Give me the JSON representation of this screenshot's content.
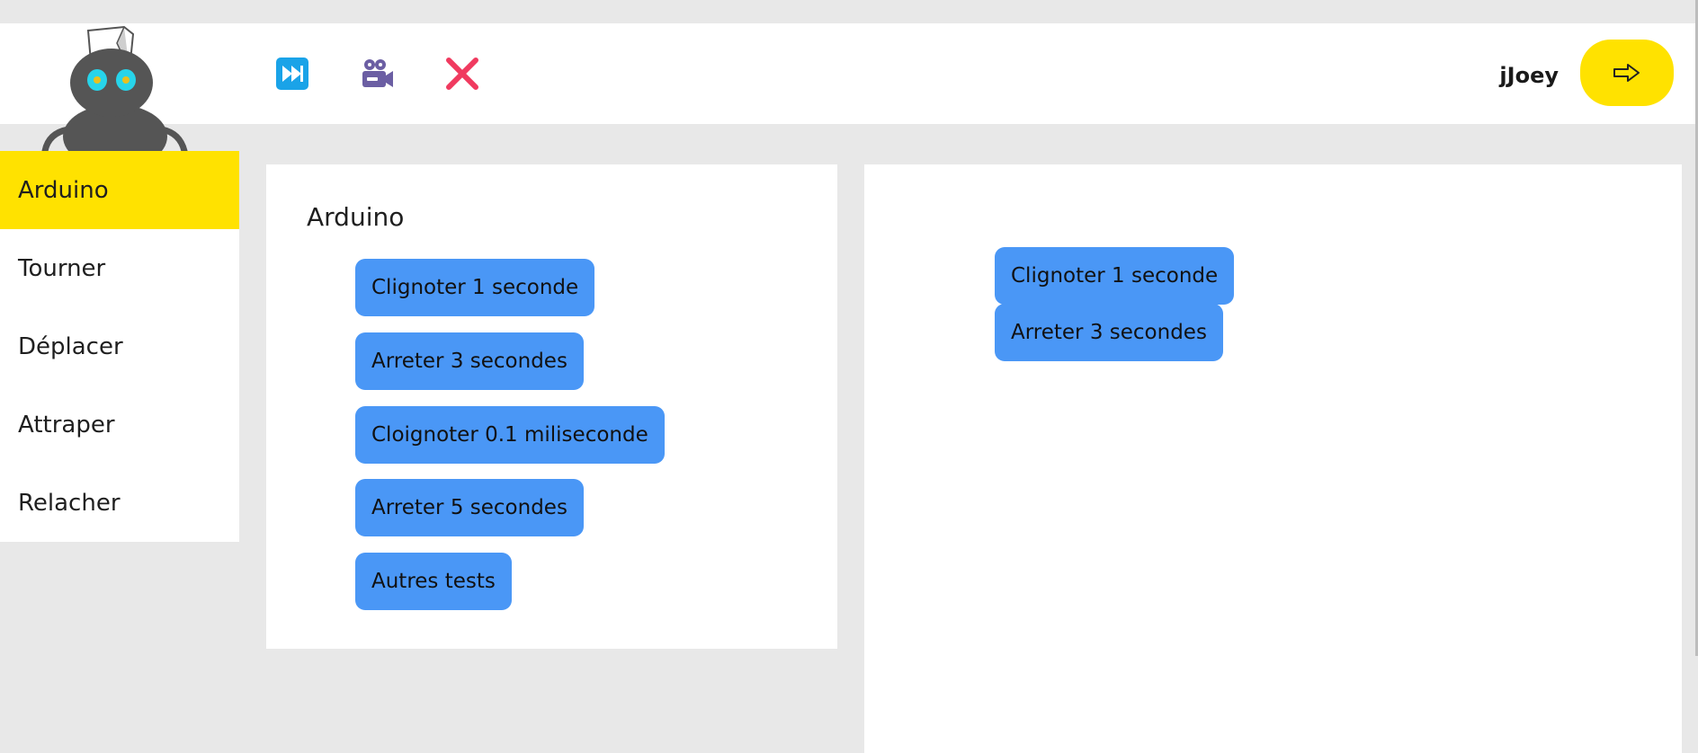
{
  "header": {
    "username": "jJoey",
    "tools": [
      {
        "icon": "fast-forward-icon",
        "color": "#1aa3e8"
      },
      {
        "icon": "video-camera-icon",
        "color": "#6b5ea3"
      },
      {
        "icon": "close-icon",
        "color": "#f03a5f"
      }
    ],
    "logout_icon": "logout-arrow-icon"
  },
  "sidebar": {
    "items": [
      {
        "label": "Arduino",
        "active": true
      },
      {
        "label": "Tourner",
        "active": false
      },
      {
        "label": "Déplacer",
        "active": false
      },
      {
        "label": "Attraper",
        "active": false
      },
      {
        "label": "Relacher",
        "active": false
      }
    ]
  },
  "palette": {
    "title": "Arduino",
    "blocks": [
      {
        "label": "Clignoter 1 seconde"
      },
      {
        "label": "Arreter 3 secondes"
      },
      {
        "label": "Cloignoter 0.1 miliseconde"
      },
      {
        "label": "Arreter 5 secondes"
      },
      {
        "label": "Autres tests"
      }
    ]
  },
  "workspace": {
    "blocks": [
      {
        "label": "Clignoter 1 seconde"
      },
      {
        "label": "Arreter 3 secondes"
      }
    ]
  },
  "colors": {
    "accent_yellow": "#ffe200",
    "block_blue": "#4a97f6",
    "background_gray": "#e8e8e8"
  }
}
